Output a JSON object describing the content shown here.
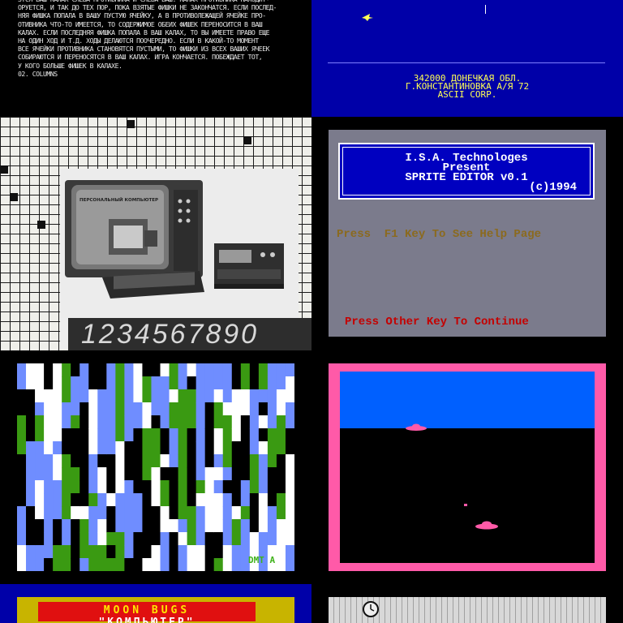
{
  "rules": {
    "lines": [
      "ЗТСЯ ВАШ КАЛАХ СЛЕВА ПРОТИВНИКА И СЛЕВА ВАШ. КАЛАХ ПРОТИВНИКА НАХОДИТ-",
      "ОРУЕТСЯ, И ТАК ДО ТЕХ ПОР, ПОКА ВЗЯТЫЕ ФИШКИ НЕ ЗАКОНЧАТСЯ. ЕСЛИ ПОСЛЕД-",
      "НЯЯ ФИШКА ПОПАЛА В ВАШУ ПУСТУЮ ЯЧЕЙКУ, А В ПРОТИВОЛЕЖАЩЕЙ ЯЧЕЙКЕ ПРО-",
      "ОТИВНИКА ЧТО-ТО ИМЕЕТСЯ, ТО СОДЕРЖИМОЕ ОБЕИХ ФИШЕК ПЕРЕНОСИТСЯ В ВАШ",
      "КАЛАХ. ЕСЛИ ПОСЛЕДНЯЯ ФИШКА ПОПАЛА В ВАШ КАЛАХ, ТО ВЫ ИМЕЕТЕ ПРАВО ЕЩЕ",
      "НА ОДИН ХОД И Т.Д. ХОДЫ ДЕЛАЮТСЯ ПООЧЕРЕДНО. ЕСЛИ В КАКОЙ-ТО МОМЕНТ",
      "ВСЕ ЯЧЕЙКИ ПРОТИВНИКА СТАНОВЯТСЯ ПУСТЫМИ, ТО ФИШКИ ИЗ ВСЕХ ВАШИХ ЯЧЕЕК",
      "СОБИРАЮТСЯ И ПЕРЕНОСЯТСЯ В ВАШ КАЛАХ. ИГРА КОНЧАЕТСЯ. ПОБЕЖДАЕТ ТОТ,",
      "У КОГО БОЛЬШЕ ФИШЕК В КАЛАХЕ.",
      "02. COLUMNS"
    ]
  },
  "credits": {
    "line1": "342000 ДОНЕЧКАЯ ОБЛ.",
    "line2": "Г.КОНСТАНТИНОВКА А/Я 72",
    "line3": "ASCII CORP."
  },
  "photo": {
    "screen_caption": "ПЕРСОНАЛЬНЫЙ КОМПЬЮТЕР",
    "digits": "1234567890"
  },
  "sprite_editor": {
    "company": "I.S.A. Technologes",
    "present": "Present",
    "title": "SPRITE EDITOR v0.1",
    "year": "(c)1994",
    "help_prompt": "Press  F1 Key To See Help Page",
    "continue_prompt": "Press Other Key To Continue",
    "colors": {
      "panel": "#7b7b8c",
      "banner": "#0000c0",
      "help": "#8b6a1e",
      "continue": "#c40000"
    }
  },
  "pattern": {
    "tag": "DMT A",
    "colors": [
      "#ffffff",
      "#6f8dff",
      "#3a9a12",
      "#000000"
    ]
  },
  "space_scene": {
    "colors": {
      "frame": "#ff5aa8",
      "sky": "#0060ff",
      "ground": "#000000"
    }
  },
  "moon_bugs": {
    "title": "MOON BUGS",
    "subtitle": "\"КОМПЬЮТЕР\""
  }
}
